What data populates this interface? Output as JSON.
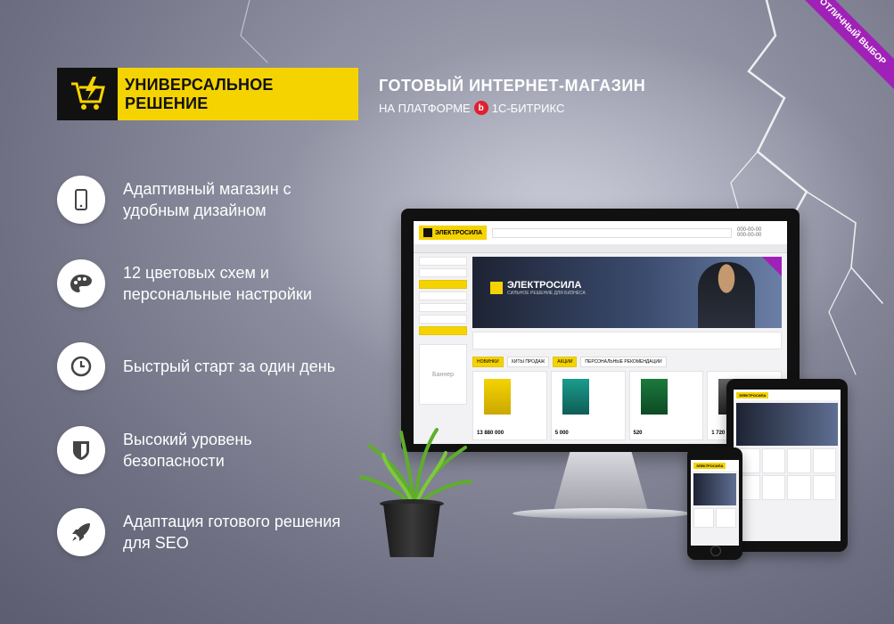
{
  "ribbon": {
    "text": "Отличный выбор"
  },
  "logo": {
    "text": "УНИВЕРСАЛЬНОЕ РЕШЕНИЕ"
  },
  "headline": {
    "title": "ГОТОВЫЙ ИНТЕРНЕТ-МАГАЗИН",
    "subtitle_prefix": "НА ПЛАТФОРМЕ",
    "platform": "1С-БИТРИКС"
  },
  "features": [
    {
      "text": "Адаптивный магазин с удобным дизайном",
      "icon": "smartphone-icon"
    },
    {
      "text": "12 цветовых схем и персональные настройки",
      "icon": "palette-icon"
    },
    {
      "text": "Быстрый старт за один день",
      "icon": "clock-icon"
    },
    {
      "text": "Высокий уровень безопасности",
      "icon": "shield-icon"
    },
    {
      "text": "Адаптация готового решения для SEO",
      "icon": "rocket-icon"
    }
  ],
  "mockup": {
    "brand": "ЭЛЕКТРОСИЛА",
    "hero_title": "ЭЛЕКТРОСИЛА",
    "hero_sub": "СИЛЬНОЕ РЕШЕНИЕ ДЛЯ БИЗНЕСА",
    "banner_label": "Баннер",
    "tabs": [
      "НОВИНКИ",
      "ХИТЫ ПРОДАЖ",
      "АКЦИИ",
      "ПЕРСОНАЛЬНЫЕ РЕКОМЕНДАЦИИ"
    ],
    "prices": [
      "13 880 000",
      "5 000",
      "520",
      "1 720"
    ]
  },
  "colors": {
    "accent": "#f5d300",
    "ribbon": "#a021b8",
    "dark": "#111111"
  }
}
